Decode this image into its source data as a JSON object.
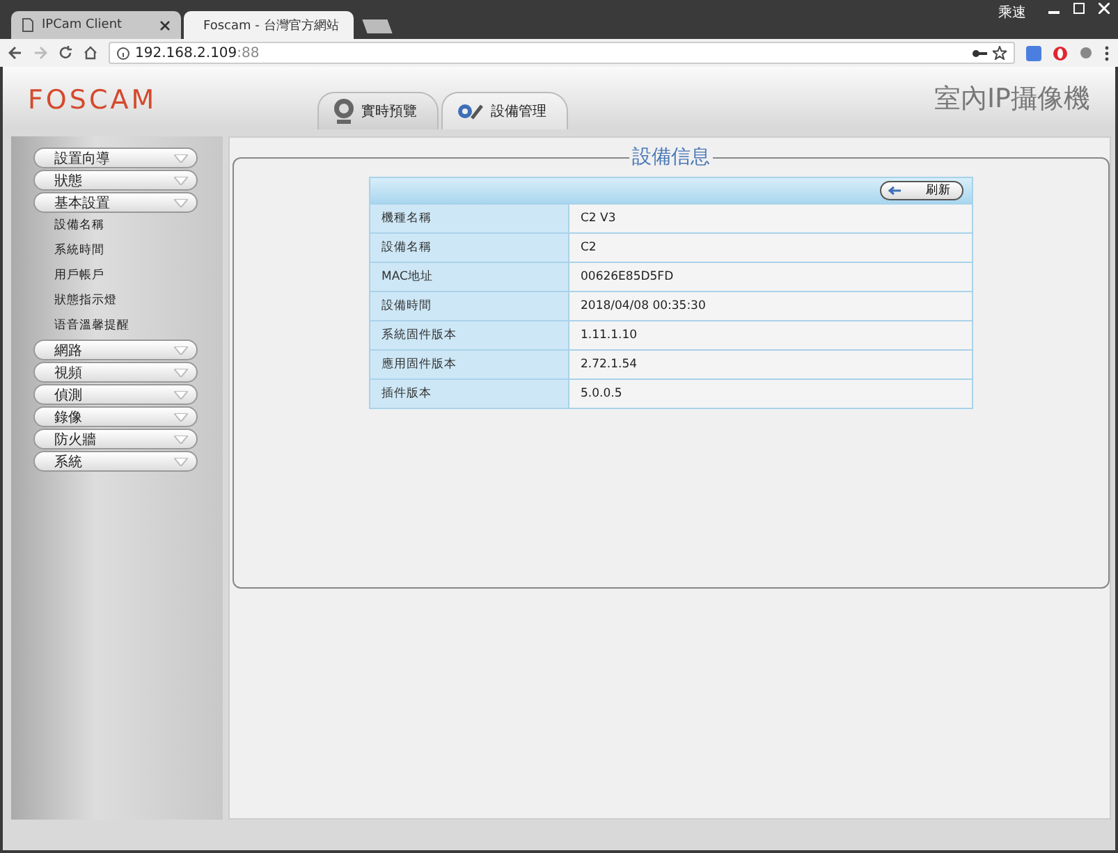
{
  "browser": {
    "profile": "乘速",
    "tabs": [
      {
        "title": "IPCam Client",
        "selected": false
      },
      {
        "title": "Foscam - 台灣官方網站",
        "selected": true
      }
    ],
    "address": {
      "host": "192.168.2.109",
      "port": ":88"
    }
  },
  "header": {
    "logo": "FOSCAM",
    "product": "室內IP攝像機",
    "tabs": [
      {
        "label": "實時預覽",
        "kind": "camera",
        "selected": false
      },
      {
        "label": "設備管理",
        "kind": "tools",
        "selected": true
      }
    ]
  },
  "sidebar": {
    "items": [
      {
        "label": "設置向導"
      },
      {
        "label": "狀態"
      },
      {
        "label": "基本設置",
        "children": [
          {
            "label": "設備名稱"
          },
          {
            "label": "系統時間"
          },
          {
            "label": "用戶帳戶"
          },
          {
            "label": "狀態指示燈"
          },
          {
            "label": "语音溫馨提醒"
          }
        ]
      },
      {
        "label": "網路"
      },
      {
        "label": "視頻"
      },
      {
        "label": "偵測"
      },
      {
        "label": "錄像"
      },
      {
        "label": "防火牆"
      },
      {
        "label": "系統"
      }
    ]
  },
  "panel": {
    "title": "設備信息",
    "refresh": "刷新",
    "rows": [
      {
        "label": "機種名稱",
        "value": "C2 V3"
      },
      {
        "label": "設備名稱",
        "value": "C2"
      },
      {
        "label": "MAC地址",
        "value": "00626E85D5FD"
      },
      {
        "label": "設備時間",
        "value": "2018/04/08 00:35:30"
      },
      {
        "label": "系統固件版本",
        "value": "1.11.1.10"
      },
      {
        "label": "應用固件版本",
        "value": "2.72.1.54"
      },
      {
        "label": "插件版本",
        "value": "5.0.0.5"
      }
    ]
  }
}
